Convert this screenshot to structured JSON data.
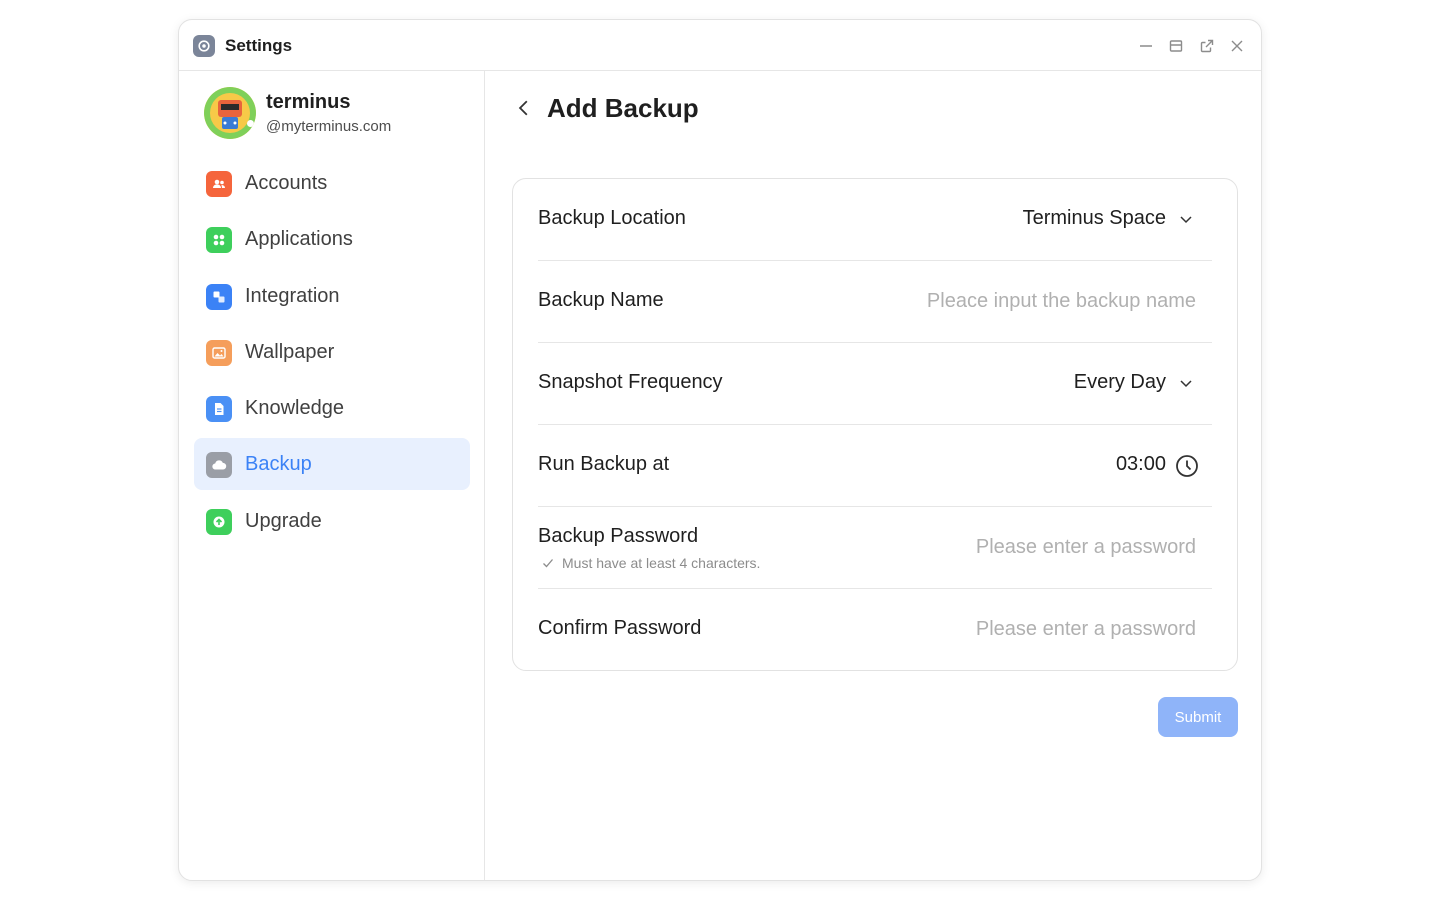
{
  "window": {
    "title": "Settings",
    "controls": [
      "minimize-icon",
      "maximize-icon",
      "popout-icon",
      "close-icon"
    ]
  },
  "profile": {
    "name": "terminus",
    "email": "@myterminus.com"
  },
  "sidebar": {
    "items": [
      {
        "label": "Accounts",
        "icon": "accounts-icon",
        "color": "#f5653c"
      },
      {
        "label": "Applications",
        "icon": "applications-icon",
        "color": "#3ecf5c"
      },
      {
        "label": "Integration",
        "icon": "integration-icon",
        "color": "#3b82f6"
      },
      {
        "label": "Wallpaper",
        "icon": "wallpaper-icon",
        "color": "#f59e5b"
      },
      {
        "label": "Knowledge",
        "icon": "knowledge-icon",
        "color": "#4a90f5"
      },
      {
        "label": "Backup",
        "icon": "backup-icon",
        "color": "#9a9ea6",
        "active": true
      },
      {
        "label": "Upgrade",
        "icon": "upgrade-icon",
        "color": "#3ecf5c"
      }
    ]
  },
  "main": {
    "title": "Add Backup",
    "form": {
      "location": {
        "label": "Backup Location",
        "value": "Terminus Space"
      },
      "name": {
        "label": "Backup Name",
        "placeholder": "Pleace input the backup name"
      },
      "frequency": {
        "label": "Snapshot Frequency",
        "value": "Every Day"
      },
      "run_at": {
        "label": "Run Backup at",
        "value": "03:00"
      },
      "password": {
        "label": "Backup Password",
        "hint": "Must have at least 4 characters.",
        "placeholder": "Please enter a password"
      },
      "confirm": {
        "label": "Confirm Password",
        "placeholder": "Please enter a password"
      }
    },
    "submit_label": "Submit"
  },
  "colors": {
    "accent": "#3b82f6",
    "active_bg": "#e8f0fe",
    "submit_bg": "#8fb4f9"
  }
}
